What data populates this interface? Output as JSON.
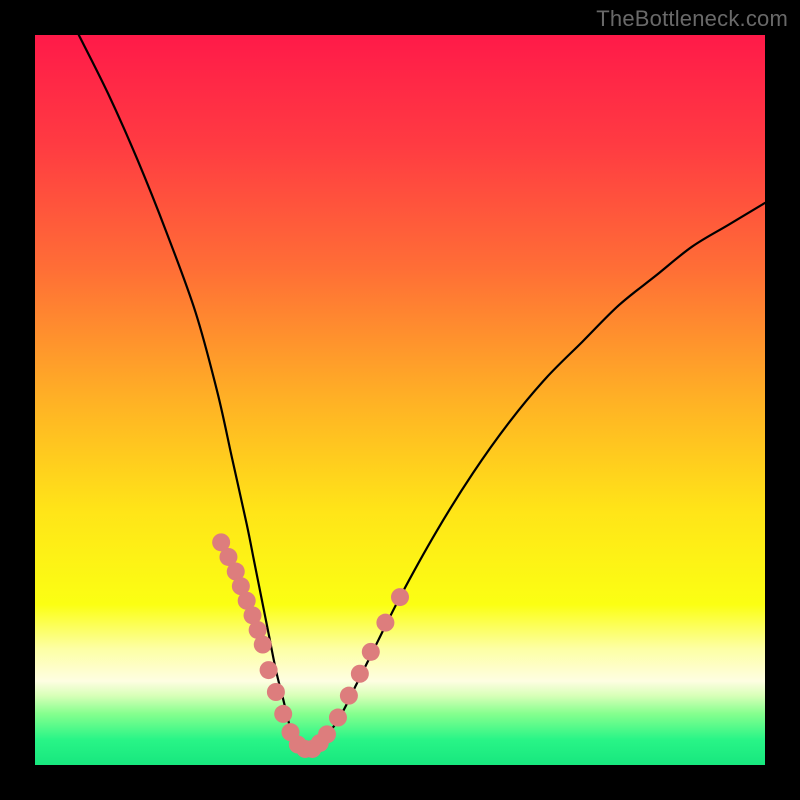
{
  "watermark": {
    "text": "TheBottleneck.com"
  },
  "chart_data": {
    "type": "line",
    "title": "",
    "xlabel": "",
    "ylabel": "",
    "xlim": [
      0,
      100
    ],
    "ylim": [
      0,
      100
    ],
    "grid": false,
    "series": [
      {
        "name": "curve",
        "x": [
          6,
          10,
          14,
          18,
          22,
          25,
          27,
          29,
          30,
          31,
          32,
          33,
          34,
          35,
          36,
          37,
          38,
          39,
          40,
          42,
          44,
          46,
          50,
          55,
          60,
          65,
          70,
          75,
          80,
          85,
          90,
          95,
          100
        ],
        "values": [
          100,
          92,
          83,
          73,
          62,
          51,
          42,
          33,
          28,
          23,
          18,
          13,
          9,
          5,
          3,
          2,
          2,
          3,
          4,
          7,
          11,
          15,
          23,
          32,
          40,
          47,
          53,
          58,
          63,
          67,
          71,
          74,
          77
        ]
      }
    ],
    "markers": {
      "comment": "pink beads along lower portion of V",
      "x": [
        25.5,
        26.5,
        27.5,
        28.2,
        29.0,
        29.8,
        30.5,
        31.2,
        32.0,
        33.0,
        34.0,
        35.0,
        36.0,
        37.0,
        38.0,
        39.0,
        40.0,
        41.5,
        43.0,
        44.5,
        46.0,
        48.0,
        50.0
      ],
      "values": [
        30.5,
        28.5,
        26.5,
        24.5,
        22.5,
        20.5,
        18.5,
        16.5,
        13.0,
        10.0,
        7.0,
        4.5,
        2.8,
        2.2,
        2.2,
        3.0,
        4.2,
        6.5,
        9.5,
        12.5,
        15.5,
        19.5,
        23.0
      ],
      "color": "#dd7d7d",
      "radius": 9
    },
    "background_gradient": {
      "stops": [
        {
          "offset": 0.0,
          "color": "#ff1a49"
        },
        {
          "offset": 0.15,
          "color": "#ff3b42"
        },
        {
          "offset": 0.32,
          "color": "#ff6e36"
        },
        {
          "offset": 0.5,
          "color": "#ffb125"
        },
        {
          "offset": 0.65,
          "color": "#ffe418"
        },
        {
          "offset": 0.78,
          "color": "#fbff13"
        },
        {
          "offset": 0.84,
          "color": "#fdffa3"
        },
        {
          "offset": 0.885,
          "color": "#fefee2"
        },
        {
          "offset": 0.905,
          "color": "#d8ffb8"
        },
        {
          "offset": 0.93,
          "color": "#85ff8e"
        },
        {
          "offset": 0.965,
          "color": "#29f587"
        },
        {
          "offset": 1.0,
          "color": "#17e77e"
        }
      ]
    }
  }
}
